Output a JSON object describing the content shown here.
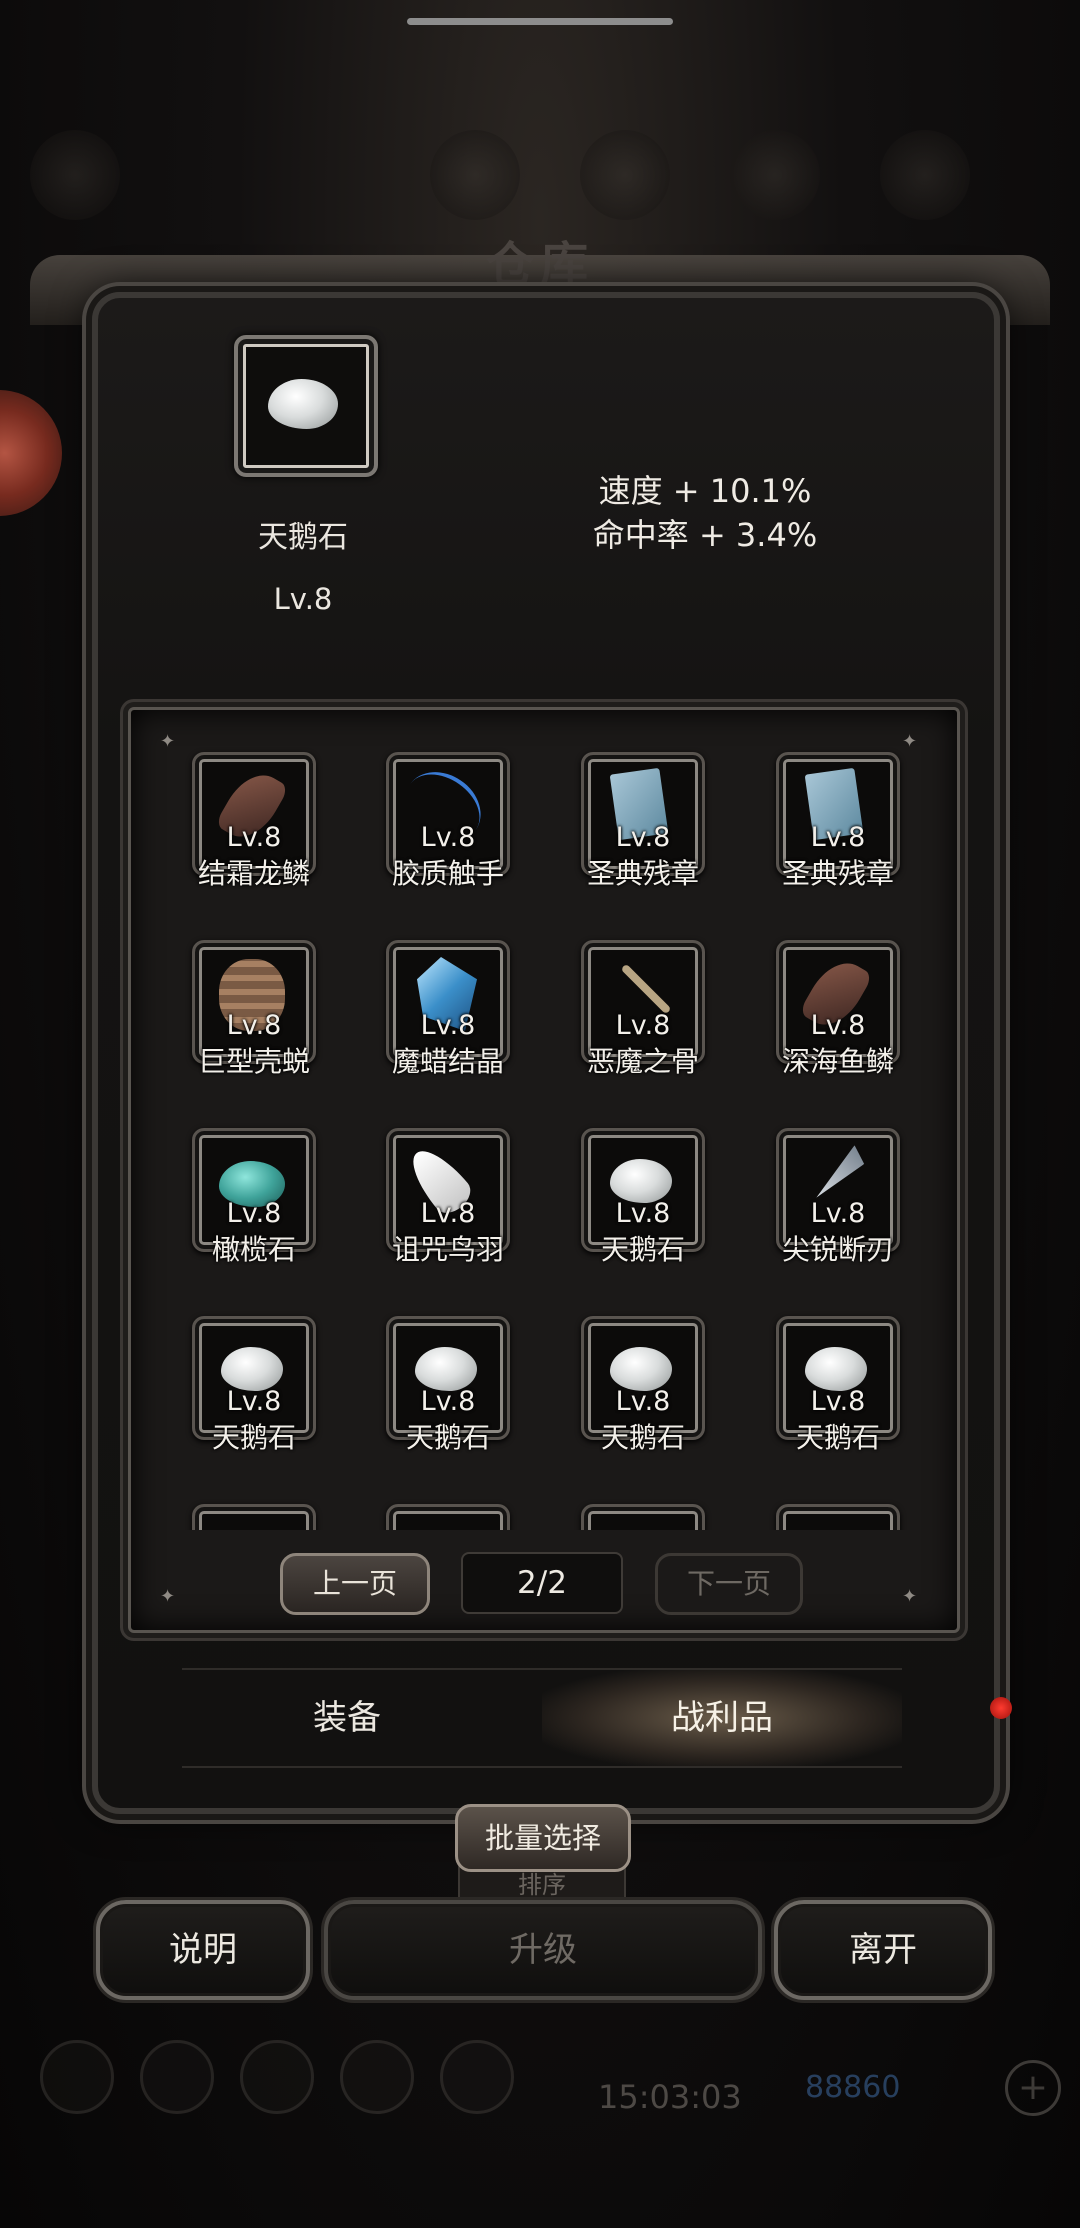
{
  "title": "仓库",
  "selected_item": {
    "name": "天鹅石",
    "level": "Lv.8",
    "stats": [
      "速度 + 10.1%",
      "命中率 + 3.4%"
    ]
  },
  "inventory": [
    {
      "name": "结霜龙鳞",
      "level": "Lv.8",
      "icon": "scale-icon"
    },
    {
      "name": "胶质触手",
      "level": "Lv.8",
      "icon": "tentacle-icon"
    },
    {
      "name": "圣典残章",
      "level": "Lv.8",
      "icon": "page-icon"
    },
    {
      "name": "圣典残章",
      "level": "Lv.8",
      "icon": "page-icon"
    },
    {
      "name": "巨型壳蜕",
      "level": "Lv.8",
      "icon": "shell-icon"
    },
    {
      "name": "魔蜡结晶",
      "level": "Lv.8",
      "icon": "crystal-icon"
    },
    {
      "name": "恶魔之骨",
      "level": "Lv.8",
      "icon": "bone-icon"
    },
    {
      "name": "深海鱼鳞",
      "level": "Lv.8",
      "icon": "scale-icon"
    },
    {
      "name": "橄榄石",
      "level": "Lv.8",
      "icon": "olivine-icon"
    },
    {
      "name": "诅咒鸟羽",
      "level": "Lv.8",
      "icon": "feather-icon"
    },
    {
      "name": "天鹅石",
      "level": "Lv.8",
      "icon": "stone-icon"
    },
    {
      "name": "尖锐断刃",
      "level": "Lv.8",
      "icon": "blade-icon"
    },
    {
      "name": "天鹅石",
      "level": "Lv.8",
      "icon": "stone-icon"
    },
    {
      "name": "天鹅石",
      "level": "Lv.8",
      "icon": "stone-icon"
    },
    {
      "name": "天鹅石",
      "level": "Lv.8",
      "icon": "stone-icon"
    },
    {
      "name": "天鹅石",
      "level": "Lv.8",
      "icon": "stone-icon"
    }
  ],
  "pager": {
    "prev": "上一页",
    "page": "2/2",
    "next": "下一页"
  },
  "tabs": {
    "equipment": "装备",
    "loot": "战利品",
    "active": "loot"
  },
  "buttons": {
    "batch_select": "批量选择",
    "sort": "排序",
    "explain": "说明",
    "upgrade": "升级",
    "leave": "离开"
  },
  "background": {
    "time": "15:03:03",
    "coins": "88860"
  },
  "colors": {
    "panel": "#141312",
    "frame": "#595550",
    "text": "#ece8e0",
    "disabled_text": "#6f6a64",
    "notification": "#ff3b30"
  }
}
